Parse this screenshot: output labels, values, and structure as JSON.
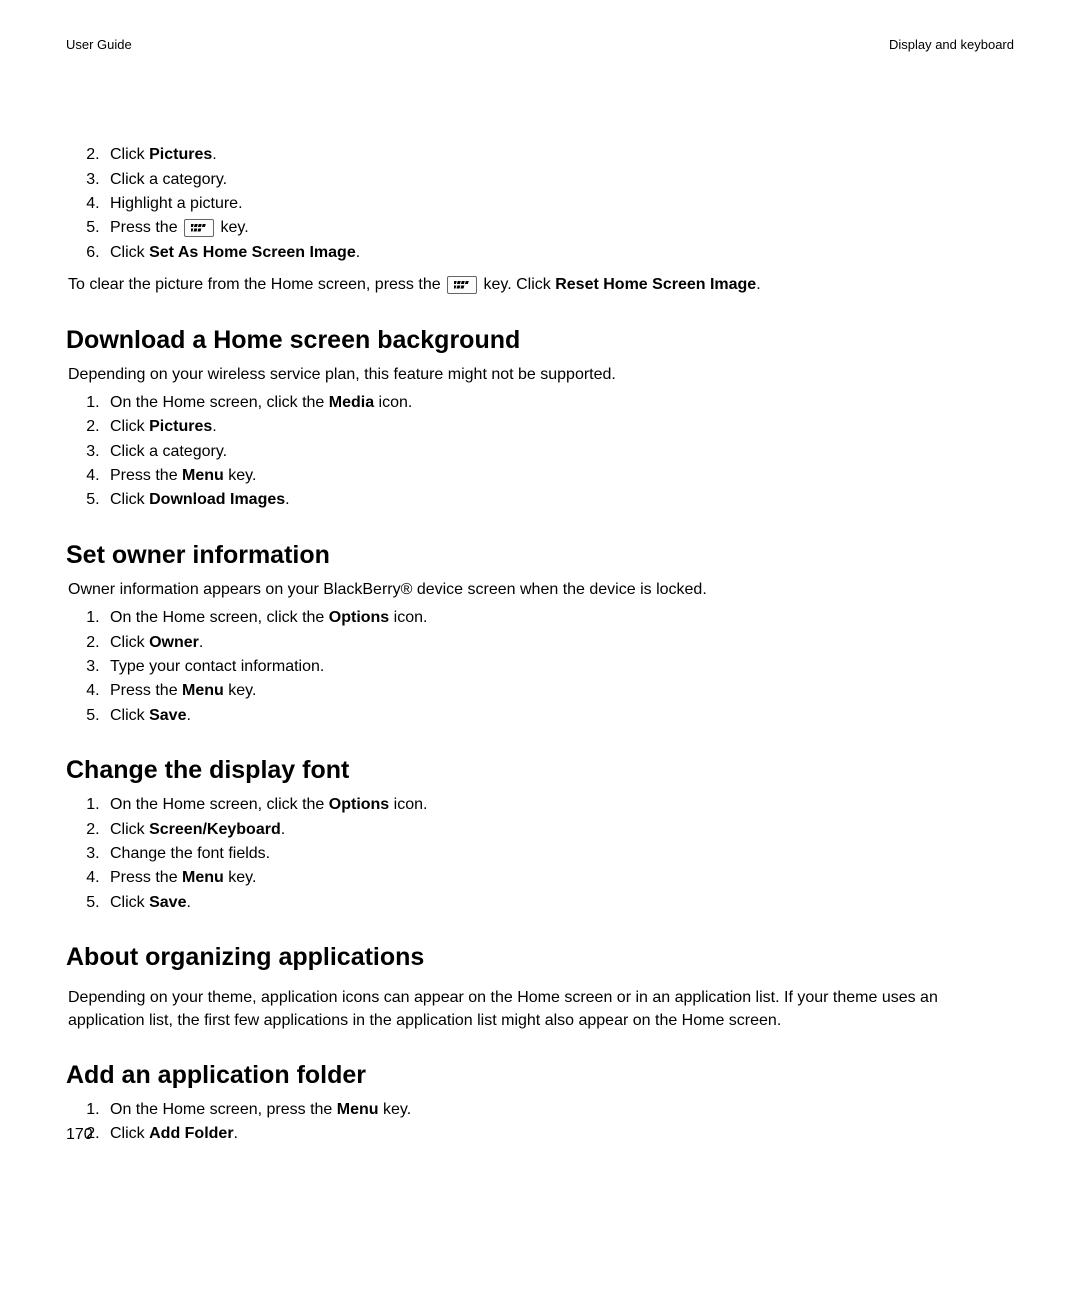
{
  "header": {
    "left": "User Guide",
    "right": "Display and keyboard"
  },
  "continuedList": {
    "start": 2,
    "items": [
      {
        "prefix": "Click ",
        "bold": "Pictures",
        "suffix": "."
      },
      {
        "text": "Click a category."
      },
      {
        "text": "Highlight a picture."
      },
      {
        "pressKey": {
          "prefix": "Press the ",
          "suffix": " key."
        }
      },
      {
        "prefix": "Click ",
        "bold": "Set As Home Screen Image",
        "suffix": "."
      }
    ]
  },
  "clearNote": {
    "prefix": "To clear the picture from the Home screen, press the ",
    "middle": " key. Click ",
    "bold": "Reset Home Screen Image",
    "suffix": "."
  },
  "sectionDownload": {
    "heading": "Download a Home screen background",
    "intro": "Depending on your wireless service plan, this feature might not be supported.",
    "items": [
      {
        "prefix": "On the Home screen, click the ",
        "bold": "Media",
        "suffix": " icon."
      },
      {
        "prefix": "Click ",
        "bold": "Pictures",
        "suffix": "."
      },
      {
        "text": "Click a category."
      },
      {
        "prefix": "Press the ",
        "bold": "Menu",
        "suffix": " key."
      },
      {
        "prefix": "Click ",
        "bold": "Download Images",
        "suffix": "."
      }
    ]
  },
  "sectionOwner": {
    "heading": "Set owner information",
    "intro": "Owner information appears on your BlackBerry® device screen when the device is locked.",
    "items": [
      {
        "prefix": "On the Home screen, click the ",
        "bold": "Options",
        "suffix": " icon."
      },
      {
        "prefix": "Click ",
        "bold": "Owner",
        "suffix": "."
      },
      {
        "text": "Type your contact information."
      },
      {
        "prefix": "Press the ",
        "bold": "Menu",
        "suffix": " key."
      },
      {
        "prefix": "Click ",
        "bold": "Save",
        "suffix": "."
      }
    ]
  },
  "sectionFont": {
    "heading": "Change the display font",
    "items": [
      {
        "prefix": "On the Home screen, click the ",
        "bold": "Options",
        "suffix": " icon."
      },
      {
        "prefix": "Click ",
        "bold": "Screen/Keyboard",
        "suffix": "."
      },
      {
        "text": "Change the font fields."
      },
      {
        "prefix": "Press the ",
        "bold": "Menu",
        "suffix": " key."
      },
      {
        "prefix": "Click ",
        "bold": "Save",
        "suffix": "."
      }
    ]
  },
  "sectionOrganize": {
    "heading": "About organizing applications",
    "intro": "Depending on your theme, application icons can appear on the Home screen or in an application list. If your theme uses an application list, the first few applications in the application list might also appear on the Home screen."
  },
  "sectionAddFolder": {
    "heading": "Add an application folder",
    "items": [
      {
        "prefix": "On the Home screen, press the ",
        "bold": "Menu",
        "suffix": " key."
      },
      {
        "prefix": "Click ",
        "bold": "Add Folder",
        "suffix": "."
      }
    ]
  },
  "pageNumber": "170"
}
